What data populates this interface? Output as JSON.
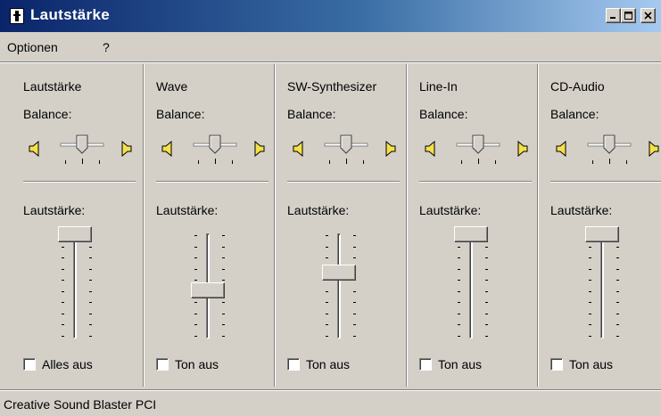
{
  "window": {
    "title": "Lautstärke",
    "icon": "speaker-app-icon",
    "controls": [
      "minimize-icon",
      "maximize-icon",
      "close-icon"
    ]
  },
  "menu": {
    "items": [
      "Optionen",
      "?"
    ]
  },
  "channels": [
    {
      "name": "Lautstärke",
      "balance_label": "Balance:",
      "volume_label": "Lautstärke:",
      "volume_level": 1.0,
      "balance": 0.5,
      "mute_label": "Alles aus",
      "muted": false
    },
    {
      "name": "Wave",
      "balance_label": "Balance:",
      "volume_label": "Lautstärke:",
      "volume_level": 0.45,
      "balance": 0.5,
      "mute_label": "Ton aus",
      "muted": false
    },
    {
      "name": "SW-Synthesizer",
      "balance_label": "Balance:",
      "volume_label": "Lautstärke:",
      "volume_level": 0.62,
      "balance": 0.5,
      "mute_label": "Ton aus",
      "muted": false
    },
    {
      "name": "Line-In",
      "balance_label": "Balance:",
      "volume_label": "Lautstärke:",
      "volume_level": 1.0,
      "balance": 0.5,
      "mute_label": "Ton aus",
      "muted": false
    },
    {
      "name": "CD-Audio",
      "balance_label": "Balance:",
      "volume_label": "Lautstärke:",
      "volume_level": 1.0,
      "balance": 0.5,
      "mute_label": "Ton aus",
      "muted": false
    }
  ],
  "status": {
    "text": "Creative Sound Blaster PCI"
  },
  "colors": {
    "titlebar_start": "#0a246a",
    "titlebar_end": "#a6caf0",
    "face": "#d4d0c8",
    "speaker": "#f4e04a"
  }
}
